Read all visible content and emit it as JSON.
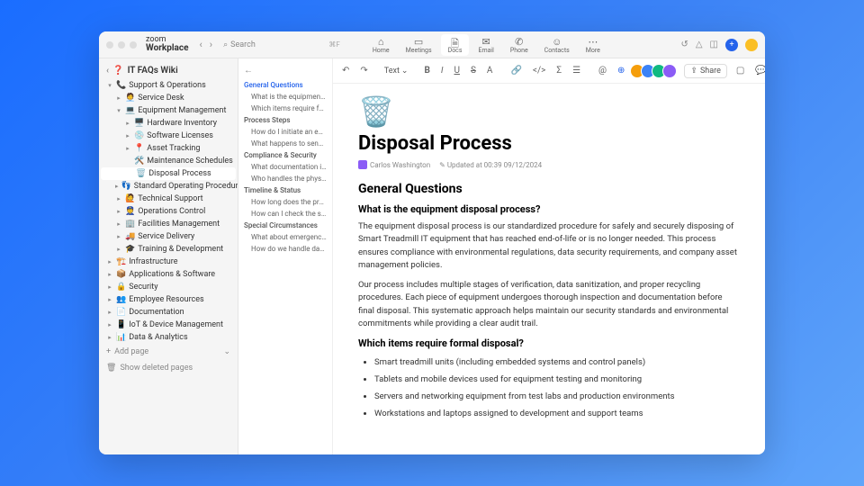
{
  "brand": {
    "line1": "zoom",
    "line2": "Workplace"
  },
  "search": {
    "label": "Search",
    "kbd": "⌘F"
  },
  "toptabs": [
    {
      "icon": "⌂",
      "label": "Home"
    },
    {
      "icon": "▭",
      "label": "Meetings"
    },
    {
      "icon": "🗎",
      "label": "Docs",
      "active": true
    },
    {
      "icon": "✉",
      "label": "Email"
    },
    {
      "icon": "✆",
      "label": "Phone"
    },
    {
      "icon": "☺",
      "label": "Contacts"
    },
    {
      "icon": "⋯",
      "label": "More"
    }
  ],
  "wiki": {
    "title": "IT FAQs Wiki",
    "icon": "❓"
  },
  "tree": [
    {
      "d": 0,
      "c": "▾",
      "e": "📞",
      "t": "Support & Operations"
    },
    {
      "d": 1,
      "c": "▸",
      "e": "🧑‍💼",
      "t": "Service Desk"
    },
    {
      "d": 1,
      "c": "▾",
      "e": "💻",
      "t": "Equipment Management"
    },
    {
      "d": 2,
      "c": "▸",
      "e": "🖥️",
      "t": "Hardware Inventory"
    },
    {
      "d": 2,
      "c": "▸",
      "e": "💿",
      "t": "Software Licenses"
    },
    {
      "d": 2,
      "c": "▸",
      "e": "📍",
      "t": "Asset Tracking"
    },
    {
      "d": 2,
      "c": "",
      "e": "🛠️",
      "t": "Maintenance Schedules"
    },
    {
      "d": 2,
      "c": "",
      "e": "🗑️",
      "t": "Disposal Process",
      "sel": true
    },
    {
      "d": 1,
      "c": "▸",
      "e": "👣",
      "t": "Standard Operating Procedures"
    },
    {
      "d": 1,
      "c": "▸",
      "e": "🙋",
      "t": "Technical Support"
    },
    {
      "d": 1,
      "c": "▸",
      "e": "👮",
      "t": "Operations Control"
    },
    {
      "d": 1,
      "c": "▸",
      "e": "🏢",
      "t": "Facilities Management"
    },
    {
      "d": 1,
      "c": "▸",
      "e": "🚚",
      "t": "Service Delivery"
    },
    {
      "d": 1,
      "c": "▸",
      "e": "🎓",
      "t": "Training & Development"
    },
    {
      "d": 0,
      "c": "▸",
      "e": "🏗️",
      "t": "Infrastructure"
    },
    {
      "d": 0,
      "c": "▸",
      "e": "📦",
      "t": "Applications & Software"
    },
    {
      "d": 0,
      "c": "▸",
      "e": "🔒",
      "t": "Security"
    },
    {
      "d": 0,
      "c": "▸",
      "e": "👥",
      "t": "Employee Resources"
    },
    {
      "d": 0,
      "c": "▸",
      "e": "📄",
      "t": "Documentation"
    },
    {
      "d": 0,
      "c": "▸",
      "e": "📱",
      "t": "IoT & Device Management"
    },
    {
      "d": 0,
      "c": "▸",
      "e": "📊",
      "t": "Data & Analytics"
    }
  ],
  "sidebar_actions": {
    "add": "Add page",
    "deleted": "Show deleted pages"
  },
  "outline": [
    {
      "l": 1,
      "t": "General Questions",
      "active": true
    },
    {
      "l": 2,
      "t": "What is the equipment disp…"
    },
    {
      "l": 2,
      "t": "Which items require formal …"
    },
    {
      "l": 1,
      "t": "Process Steps"
    },
    {
      "l": 2,
      "t": "How do I initiate an equipm…"
    },
    {
      "l": 2,
      "t": "What happens to sensitive …"
    },
    {
      "l": 1,
      "t": "Compliance & Security"
    },
    {
      "l": 2,
      "t": "What documentation is req…"
    },
    {
      "l": 2,
      "t": "Who handles the physical di…"
    },
    {
      "l": 1,
      "t": "Timeline & Status"
    },
    {
      "l": 2,
      "t": "How long does the process …"
    },
    {
      "l": 2,
      "t": "How can I check the status …"
    },
    {
      "l": 1,
      "t": "Special Circumstances"
    },
    {
      "l": 2,
      "t": "What about emergency dis…"
    },
    {
      "l": 2,
      "t": "How do we handle damage…"
    }
  ],
  "toolbar": {
    "text_label": "Text",
    "share": "Share"
  },
  "avatars": [
    "#f59e0b",
    "#3b82f6",
    "#10b981",
    "#8b5cf6"
  ],
  "doc": {
    "icon": "🗑️",
    "title": "Disposal Process",
    "author": "Carlos Washington",
    "updated": "Updated at 00:39 09/12/2024",
    "h2_1": "General Questions",
    "h3_1": "What is the equipment disposal process?",
    "p1": "The equipment disposal process is our standardized procedure for safely and securely disposing of Smart Treadmill IT equipment that has reached end-of-life or is no longer needed. This process ensures compliance with environmental regulations, data security requirements, and company asset management policies.",
    "p2": "Our process includes multiple stages of verification, data sanitization, and proper recycling procedures. Each piece of equipment undergoes thorough inspection and documentation before final disposal. This systematic approach helps maintain our security standards and environmental commitments while providing a clear audit trail.",
    "h3_2": "Which items require formal disposal?",
    "bullets": [
      "Smart treadmill units (including embedded systems and control panels)",
      "Tablets and mobile devices used for equipment testing and monitoring",
      "Servers and networking equipment from test labs and production environments",
      "Workstations and laptops assigned to development and support teams"
    ]
  }
}
